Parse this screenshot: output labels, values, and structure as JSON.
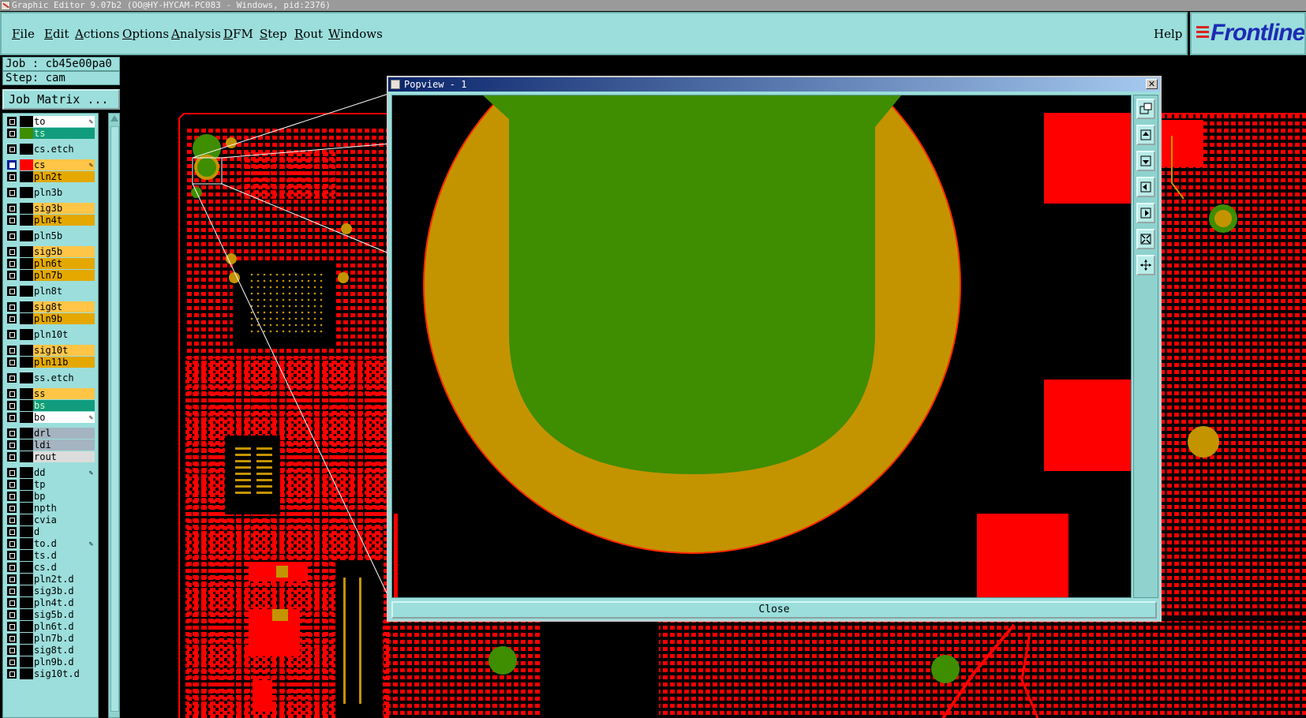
{
  "window_title": "Graphic Editor 9.07b2 (OO@HY-HYCAM-PC083 - Windows, pid:2376)",
  "menu": [
    "File",
    "Edit",
    "Actions",
    "Options",
    "Analysis",
    "DFM",
    "Step",
    "Rout",
    "Windows"
  ],
  "help_label": "Help",
  "logo_text": "Frontline",
  "job": "Job : cb45e00pa0",
  "step": "Step: cam",
  "job_matrix_label": "Job Matrix ...",
  "layers": [
    {
      "name": "to",
      "bg": "#ffffff",
      "swatch": "#000000",
      "edit": true
    },
    {
      "name": "ts",
      "bg": "#119d7d",
      "swatch": "#3f8d00",
      "text": "#d8ffc8"
    },
    {
      "name": "cs.etch",
      "bg": "#9bdedb",
      "swatch": "#000000"
    },
    {
      "name": "cs",
      "bg": "#ffc547",
      "swatch": "#ff0000",
      "active": true,
      "edit": true
    },
    {
      "name": "pln2t",
      "bg": "#e4a800",
      "swatch": "#000000"
    },
    {
      "name": "pln3b",
      "bg": "#9bdedb",
      "swatch": "#000000"
    },
    {
      "name": "sig3b",
      "bg": "#ffc547",
      "swatch": "#000000"
    },
    {
      "name": "pln4t",
      "bg": "#e4a800",
      "swatch": "#000000"
    },
    {
      "name": "pln5b",
      "bg": "#9bdedb",
      "swatch": "#000000"
    },
    {
      "name": "sig5b",
      "bg": "#ffc547",
      "swatch": "#000000"
    },
    {
      "name": "pln6t",
      "bg": "#e4a800",
      "swatch": "#000000"
    },
    {
      "name": "pln7b",
      "bg": "#e4a800",
      "swatch": "#000000"
    },
    {
      "name": "pln8t",
      "bg": "#9bdedb",
      "swatch": "#000000"
    },
    {
      "name": "sig8t",
      "bg": "#ffc547",
      "swatch": "#000000"
    },
    {
      "name": "pln9b",
      "bg": "#e4a800",
      "swatch": "#000000"
    },
    {
      "name": "pln10t",
      "bg": "#9bdedb",
      "swatch": "#000000"
    },
    {
      "name": "sig10t",
      "bg": "#ffc547",
      "swatch": "#000000"
    },
    {
      "name": "pln11b",
      "bg": "#e4a800",
      "swatch": "#000000"
    },
    {
      "name": "ss.etch",
      "bg": "#9bdedb",
      "swatch": "#000000"
    },
    {
      "name": "ss",
      "bg": "#ffc547",
      "swatch": "#000000"
    },
    {
      "name": "bs",
      "bg": "#119d7d",
      "swatch": "#000000",
      "text": "#d8ffc8"
    },
    {
      "name": "bo",
      "bg": "#ffffff",
      "swatch": "#000000",
      "edit": true
    },
    {
      "name": "drl",
      "bg": "#a4b4c0",
      "swatch": "#000000"
    },
    {
      "name": "ldi",
      "bg": "#a4b4c0",
      "swatch": "#000000"
    },
    {
      "name": "rout",
      "bg": "#dcdcdc",
      "swatch": "#000000"
    },
    {
      "name": "dd",
      "bg": "#9bdedb",
      "swatch": "#000000",
      "edit": true
    },
    {
      "name": "tp",
      "bg": "#9bdedb",
      "swatch": "#000000"
    },
    {
      "name": "bp",
      "bg": "#9bdedb",
      "swatch": "#000000"
    },
    {
      "name": "npth",
      "bg": "#9bdedb",
      "swatch": "#000000"
    },
    {
      "name": "cvia",
      "bg": "#9bdedb",
      "swatch": "#000000"
    },
    {
      "name": "d",
      "bg": "#9bdedb",
      "swatch": "#000000"
    },
    {
      "name": "to.d",
      "bg": "#9bdedb",
      "swatch": "#000000",
      "edit": true
    },
    {
      "name": "ts.d",
      "bg": "#9bdedb",
      "swatch": "#000000"
    },
    {
      "name": "cs.d",
      "bg": "#9bdedb",
      "swatch": "#000000"
    },
    {
      "name": "pln2t.d",
      "bg": "#9bdedb",
      "swatch": "#000000"
    },
    {
      "name": "sig3b.d",
      "bg": "#9bdedb",
      "swatch": "#000000"
    },
    {
      "name": "pln4t.d",
      "bg": "#9bdedb",
      "swatch": "#000000"
    },
    {
      "name": "sig5b.d",
      "bg": "#9bdedb",
      "swatch": "#000000"
    },
    {
      "name": "pln6t.d",
      "bg": "#9bdedb",
      "swatch": "#000000"
    },
    {
      "name": "pln7b.d",
      "bg": "#9bdedb",
      "swatch": "#000000"
    },
    {
      "name": "sig8t.d",
      "bg": "#9bdedb",
      "swatch": "#000000"
    },
    {
      "name": "pln9b.d",
      "bg": "#9bdedb",
      "swatch": "#000000"
    },
    {
      "name": "sig10t.d",
      "bg": "#9bdedb",
      "swatch": "#000000"
    }
  ],
  "popview": {
    "title": "Popview - 1",
    "close_label": "Close",
    "tools": [
      "zoom-window-icon",
      "pan-up-icon",
      "pan-down-icon",
      "pan-left-icon",
      "pan-right-icon",
      "zoom-fit-icon",
      "zoom-center-icon"
    ]
  },
  "colors": {
    "panel": "#9bdedb",
    "copper_red": "#ff0000",
    "pad_gold": "#c49400",
    "mask_green": "#3f8d00"
  }
}
